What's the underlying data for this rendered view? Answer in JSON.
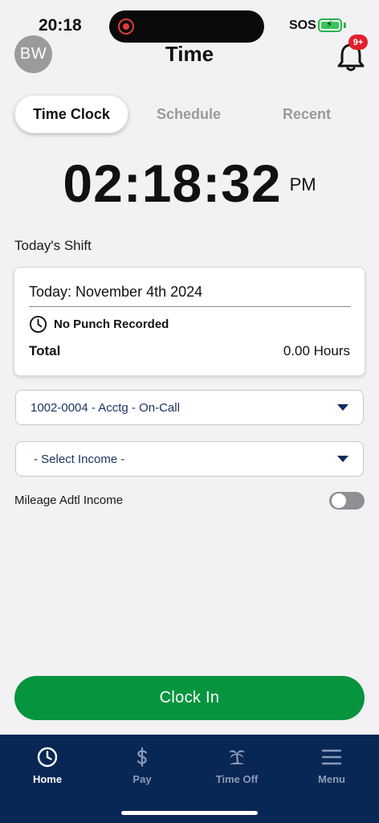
{
  "status_bar": {
    "time": "20:18",
    "network": "SOS"
  },
  "header": {
    "avatar_initials": "BW",
    "title": "Time",
    "notification_badge": "9+"
  },
  "tabs": [
    {
      "label": "Time Clock",
      "active": true
    },
    {
      "label": "Schedule",
      "active": false
    },
    {
      "label": "Recent",
      "active": false
    }
  ],
  "clock": {
    "time": "02:18:32",
    "ampm": "PM"
  },
  "shift": {
    "section_label": "Today's Shift",
    "date": "Today: November 4th 2024",
    "punch_status": "No Punch Recorded",
    "total_label": "Total",
    "total_value": "0.00 Hours"
  },
  "form": {
    "department_select": "1002-0004 - Acctg - On-Call",
    "income_select": "- Select Income -",
    "mileage_label": "Mileage Adtl Income",
    "mileage_enabled": false
  },
  "actions": {
    "clock_in_label": "Clock In"
  },
  "bottom_nav": {
    "items": [
      {
        "label": "Home",
        "icon": "clock-icon",
        "active": true
      },
      {
        "label": "Pay",
        "icon": "dollar-icon",
        "active": false
      },
      {
        "label": "Time Off",
        "icon": "palm-tree-icon",
        "active": false
      },
      {
        "label": "Menu",
        "icon": "hamburger-icon",
        "active": false
      }
    ]
  },
  "colors": {
    "primary_green": "#07943f",
    "nav_background": "#092755",
    "badge_red": "#e0202a",
    "select_text": "#1d3461"
  }
}
